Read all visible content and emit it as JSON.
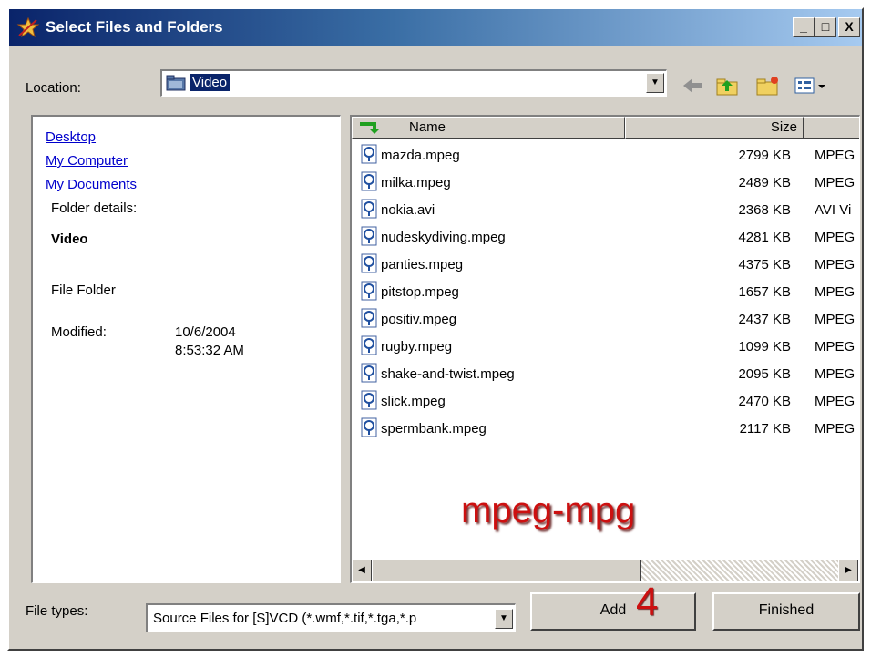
{
  "window": {
    "title": "Select Files and Folders",
    "controls": {
      "minimize": "_",
      "maximize": "□",
      "close": "X"
    }
  },
  "location": {
    "label": "Location:",
    "value": "Video",
    "icons": [
      "back-arrow-icon",
      "up-folder-icon",
      "new-folder-icon",
      "view-menu-icon"
    ]
  },
  "places": {
    "links": [
      "Desktop",
      "My Computer",
      "My Documents"
    ],
    "folder_details_label": "Folder details:",
    "folder_name": "Video",
    "folder_type": "File Folder",
    "modified_label": "Modified:",
    "modified_date": "10/6/2004",
    "modified_time": "8:53:32 AM"
  },
  "file_list": {
    "columns": {
      "name": "Name",
      "size": "Size"
    },
    "files": [
      {
        "name": "mazda.mpeg",
        "size": "2799 KB",
        "type": "MPEG"
      },
      {
        "name": "milka.mpeg",
        "size": "2489 KB",
        "type": "MPEG"
      },
      {
        "name": "nokia.avi",
        "size": "2368 KB",
        "type": "AVI Vi"
      },
      {
        "name": "nudeskydiving.mpeg",
        "size": "4281 KB",
        "type": "MPEG"
      },
      {
        "name": "panties.mpeg",
        "size": "4375 KB",
        "type": "MPEG"
      },
      {
        "name": "pitstop.mpeg",
        "size": "1657 KB",
        "type": "MPEG"
      },
      {
        "name": "positiv.mpeg",
        "size": "2437 KB",
        "type": "MPEG"
      },
      {
        "name": "rugby.mpeg",
        "size": "1099 KB",
        "type": "MPEG"
      },
      {
        "name": "shake-and-twist.mpeg",
        "size": "2095 KB",
        "type": "MPEG"
      },
      {
        "name": "slick.mpeg",
        "size": "2470 KB",
        "type": "MPEG"
      },
      {
        "name": "spermbank.mpeg",
        "size": "2117 KB",
        "type": "MPEG"
      }
    ]
  },
  "annotations": {
    "caption": "mpeg-mpg",
    "step": "4"
  },
  "bottom": {
    "file_types_label": "File types:",
    "file_types_value": "Source Files for [S]VCD  (*.wmf,*.tif,*.tga,*.p",
    "add_label": "Add",
    "finished_label": "Finished"
  },
  "colors": {
    "title_gradient_start": "#0a246a",
    "title_gradient_end": "#a6caf0",
    "face": "#d4d0c8",
    "selection": "#0a246a",
    "link": "#0000cc",
    "annotation_red": "#cc1010"
  }
}
